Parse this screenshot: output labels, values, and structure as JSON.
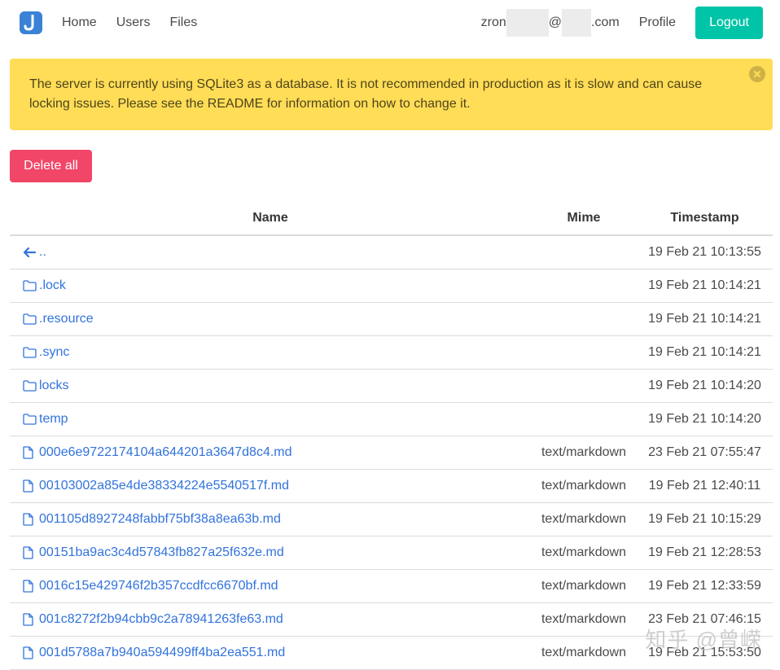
{
  "nav": {
    "items": [
      {
        "label": "Home"
      },
      {
        "label": "Users"
      },
      {
        "label": "Files"
      }
    ],
    "user_prefix": "zron",
    "user_at": "@",
    "user_suffix": ".com",
    "profile_label": "Profile",
    "logout_label": "Logout"
  },
  "notification": {
    "text": "The server is currently using SQLite3 as a database. It is not recommended in production as it is slow and can cause locking issues. Please see the README for information on how to change it."
  },
  "actions": {
    "delete_all_label": "Delete all"
  },
  "table": {
    "headers": {
      "name": "Name",
      "mime": "Mime",
      "timestamp": "Timestamp"
    },
    "rows": [
      {
        "icon": "arrow-left-icon",
        "name": "..",
        "mime": "",
        "timestamp": "19 Feb 21 10:13:55"
      },
      {
        "icon": "folder-icon",
        "name": ".lock",
        "mime": "",
        "timestamp": "19 Feb 21 10:14:21"
      },
      {
        "icon": "folder-icon",
        "name": ".resource",
        "mime": "",
        "timestamp": "19 Feb 21 10:14:21"
      },
      {
        "icon": "folder-icon",
        "name": ".sync",
        "mime": "",
        "timestamp": "19 Feb 21 10:14:21"
      },
      {
        "icon": "folder-icon",
        "name": "locks",
        "mime": "",
        "timestamp": "19 Feb 21 10:14:20"
      },
      {
        "icon": "folder-icon",
        "name": "temp",
        "mime": "",
        "timestamp": "19 Feb 21 10:14:20"
      },
      {
        "icon": "file-icon",
        "name": "000e6e9722174104a644201a3647d8c4.md",
        "mime": "text/markdown",
        "timestamp": "23 Feb 21 07:55:47"
      },
      {
        "icon": "file-icon",
        "name": "00103002a85e4de38334224e5540517f.md",
        "mime": "text/markdown",
        "timestamp": "19 Feb 21 12:40:11"
      },
      {
        "icon": "file-icon",
        "name": "001105d8927248fabbf75bf38a8ea63b.md",
        "mime": "text/markdown",
        "timestamp": "19 Feb 21 10:15:29"
      },
      {
        "icon": "file-icon",
        "name": "00151ba9ac3c4d57843fb827a25f632e.md",
        "mime": "text/markdown",
        "timestamp": "19 Feb 21 12:28:53"
      },
      {
        "icon": "file-icon",
        "name": "0016c15e429746f2b357ccdfcc6670bf.md",
        "mime": "text/markdown",
        "timestamp": "19 Feb 21 12:33:59"
      },
      {
        "icon": "file-icon",
        "name": "001c8272f2b94cbb9c2a78941263fe63.md",
        "mime": "text/markdown",
        "timestamp": "23 Feb 21 07:46:15"
      },
      {
        "icon": "file-icon",
        "name": "001d5788a7b940a594499ff4ba2ea551.md",
        "mime": "text/markdown",
        "timestamp": "19 Feb 21 15:53:50"
      }
    ]
  },
  "watermark": "知乎 @曾嵘",
  "colors": {
    "primary": "#3273dc",
    "success": "#00c4a7",
    "danger": "#f14668",
    "warning": "#ffdd57"
  }
}
